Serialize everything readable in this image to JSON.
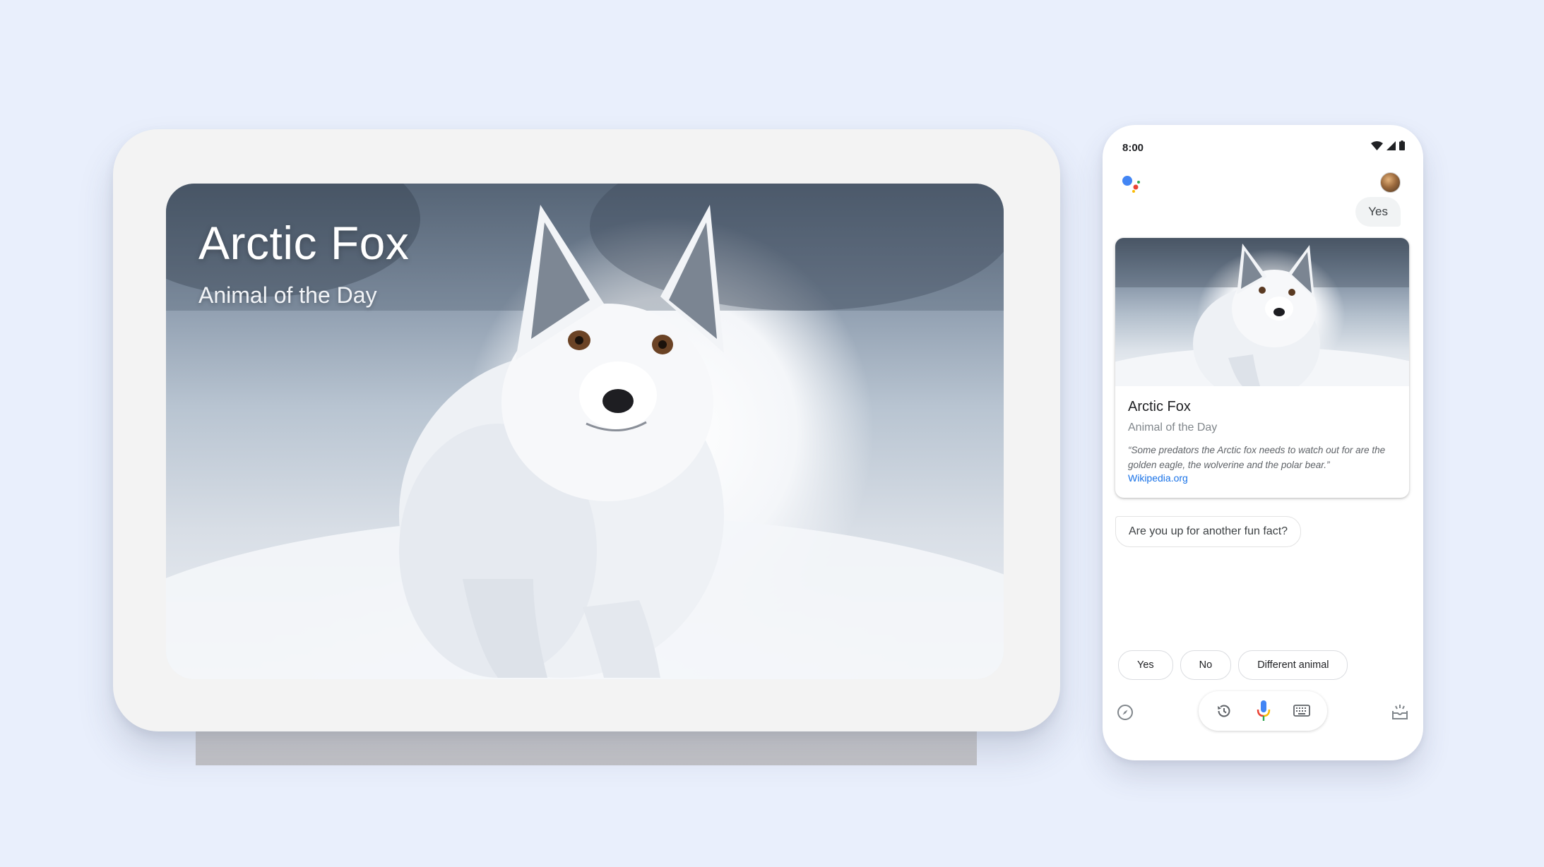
{
  "hub": {
    "title": "Arctic Fox",
    "subtitle": "Animal of the Day"
  },
  "phone": {
    "status_time": "8:00",
    "user_message": "Yes",
    "card": {
      "title": "Arctic Fox",
      "subtitle": "Animal of the Day",
      "quote": "“Some predators the Arctic fox needs to watch out for are the golden eagle, the wolverine and the polar bear.”",
      "source_link": "Wikipedia.org"
    },
    "assistant_reply": "Are you up for another fun fact?",
    "suggestions": [
      "Yes",
      "No",
      "Different animal"
    ],
    "icons": {
      "wifi": "wifi-icon",
      "signal": "cell-signal-icon",
      "battery": "battery-icon",
      "assistant": "google-assistant-icon",
      "explore": "compass-icon",
      "history": "history-icon",
      "mic": "mic-icon",
      "keyboard": "keyboard-icon",
      "updates": "updates-tray-icon"
    },
    "colors": {
      "google_blue": "#4285f4",
      "google_red": "#ea4335",
      "google_yellow": "#fbbc05",
      "google_green": "#34a853",
      "link": "#1a73e8"
    }
  }
}
